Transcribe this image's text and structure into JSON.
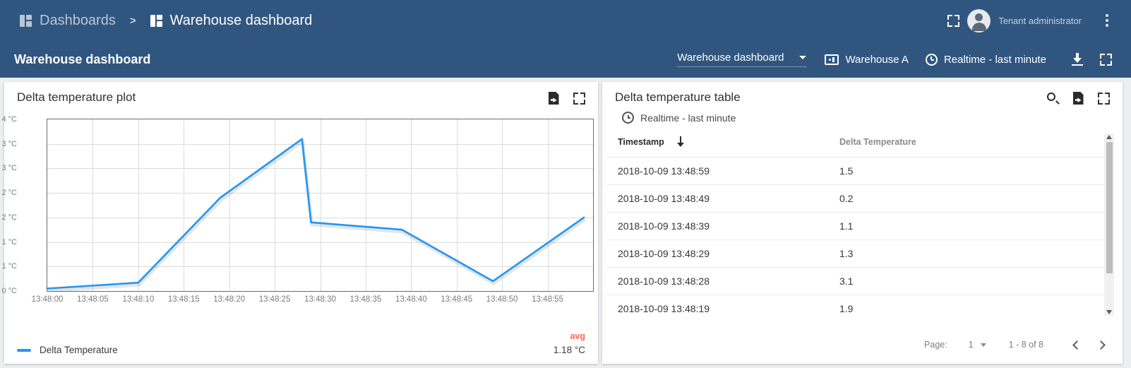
{
  "header": {
    "breadcrumb": {
      "parent": "Dashboards",
      "separator": ">",
      "current": "Warehouse dashboard"
    },
    "user_name": "Tenant administrator",
    "icons": {
      "fullscreen": "fullscreen-icon",
      "avatar": "user-avatar-icon",
      "menu": "kebab-menu-icon"
    }
  },
  "toolbar": {
    "title": "Warehouse dashboard",
    "dashboard_select": "Warehouse dashboard",
    "entity_alias": "Warehouse A",
    "timewindow": "Realtime - last minute",
    "icons": {
      "device": "device-icon",
      "clock": "clock-icon",
      "download": "download-icon",
      "fullscreen": "fullscreen-icon"
    }
  },
  "chart_widget": {
    "title": "Delta temperature plot",
    "actions": [
      "export-icon",
      "fullscreen-icon"
    ],
    "legend": {
      "series_label": "Delta Temperature",
      "agg_header": "avg",
      "agg_value": "1.18 °C"
    }
  },
  "chart_data": {
    "type": "line",
    "title": "Delta temperature plot",
    "xlabel": "",
    "ylabel": "°C",
    "ylim": [
      0,
      3.5
    ],
    "grid": true,
    "legend_position": "bottom-left",
    "line_color": "#2196f3",
    "y_ticks": [
      "4 °C",
      "3 °C",
      "3 °C",
      "2 °C",
      "2 °C",
      "1 °C",
      "1 °C",
      "0 °C"
    ],
    "y_tick_values": [
      3.5,
      3.0,
      2.5,
      2.0,
      1.5,
      1.0,
      0.5,
      0.0
    ],
    "x_ticks": [
      "13:48:00",
      "13:48:05",
      "13:48:10",
      "13:48:15",
      "13:48:20",
      "13:48:25",
      "13:48:30",
      "13:48:35",
      "13:48:40",
      "13:48:45",
      "13:48:50",
      "13:48:55"
    ],
    "series": [
      {
        "name": "Delta Temperature",
        "x": [
          "13:48:00",
          "13:48:10",
          "13:48:19",
          "13:48:28",
          "13:48:29",
          "13:48:39",
          "13:48:49",
          "13:48:59"
        ],
        "values": [
          0.05,
          0.17,
          1.9,
          3.1,
          1.4,
          1.25,
          0.2,
          1.5
        ]
      }
    ]
  },
  "table_widget": {
    "title": "Delta temperature table",
    "timewindow": "Realtime - last minute",
    "actions": [
      "search-icon",
      "export-icon",
      "fullscreen-icon"
    ],
    "columns": [
      "Timestamp",
      "Delta Temperature"
    ],
    "sort_column": "Timestamp",
    "sort_direction": "descending",
    "rows": [
      {
        "timestamp": "2018-10-09 13:48:59",
        "delta": "1.5"
      },
      {
        "timestamp": "2018-10-09 13:48:49",
        "delta": "0.2"
      },
      {
        "timestamp": "2018-10-09 13:48:39",
        "delta": "1.1"
      },
      {
        "timestamp": "2018-10-09 13:48:29",
        "delta": "1.3"
      },
      {
        "timestamp": "2018-10-09 13:48:28",
        "delta": "3.1"
      },
      {
        "timestamp": "2018-10-09 13:48:19",
        "delta": "1.9"
      }
    ],
    "pagination": {
      "page_label": "Page:",
      "page_value": "1",
      "range": "1 - 8 of 8"
    }
  },
  "colors": {
    "header_bg": "#305680",
    "accent_line": "#2196f3",
    "agg_color": "#fa6a4f",
    "page_bg": "#eceff1"
  }
}
